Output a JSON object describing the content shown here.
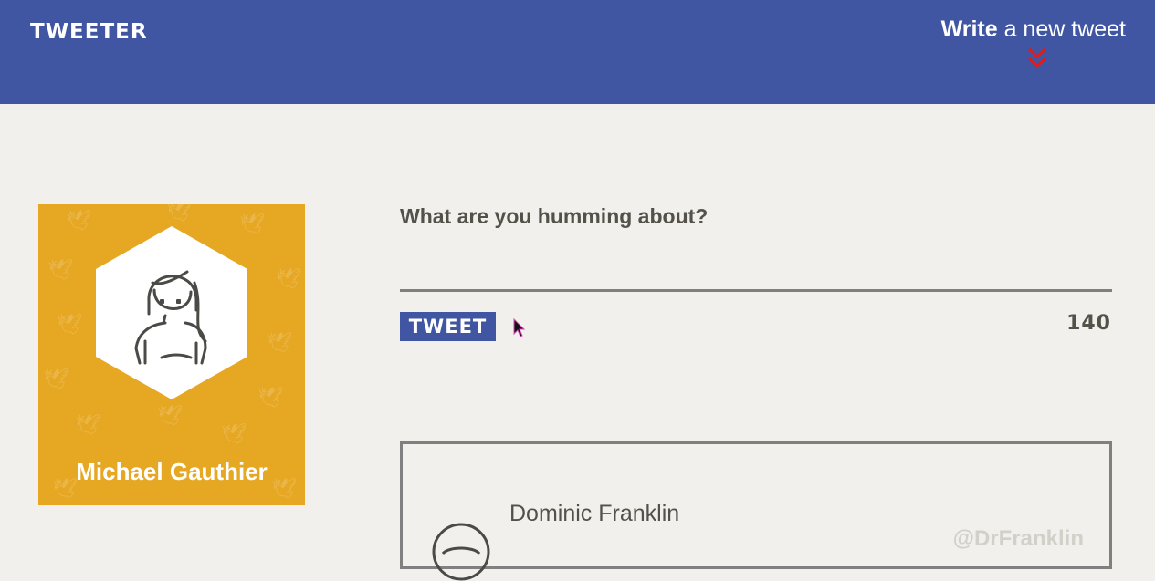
{
  "header": {
    "logo": "TWEETER",
    "compose_strong": "Write",
    "compose_rest": " a new tweet",
    "accent_color": "#4156a3",
    "chevron_color": "#e01b1b"
  },
  "profile": {
    "name": "Michael Gauthier",
    "card_color": "#e6a722",
    "avatar_icon": "user-avatar-icon"
  },
  "composer": {
    "question": "What are you humming about?",
    "input_value": "",
    "button_label": "TWEET",
    "char_counter": "140"
  },
  "feed": {
    "tweets": [
      {
        "author": "Dominic Franklin",
        "handle": "@DrFranklin",
        "avatar_icon": "user-avatar-icon"
      }
    ]
  }
}
